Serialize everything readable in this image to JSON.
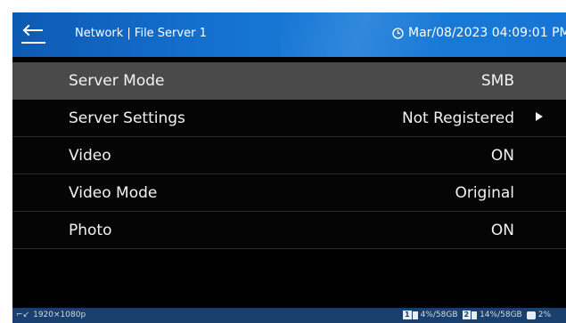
{
  "header": {
    "breadcrumb": "Network | File Server 1",
    "datetime": "Mar/08/2023 04:09:01 PM"
  },
  "menu": {
    "items": [
      {
        "label": "Server Mode",
        "value": "SMB",
        "selected": true
      },
      {
        "label": "Server Settings",
        "value": "Not Registered",
        "has_submenu": true
      },
      {
        "label": "Video",
        "value": "ON"
      },
      {
        "label": "Video Mode",
        "value": "Original"
      },
      {
        "label": "Photo",
        "value": "ON"
      }
    ]
  },
  "statusbar": {
    "resolution": "1920×1080p",
    "storage": [
      {
        "slot": "1",
        "text": "4%/58GB"
      },
      {
        "slot": "2",
        "text": "14%/58GB"
      },
      {
        "text": "2%"
      }
    ]
  },
  "colors": {
    "header_blue": "#1470cf",
    "status_blue": "#183f6e",
    "selected_row": "#4a4a4a"
  }
}
